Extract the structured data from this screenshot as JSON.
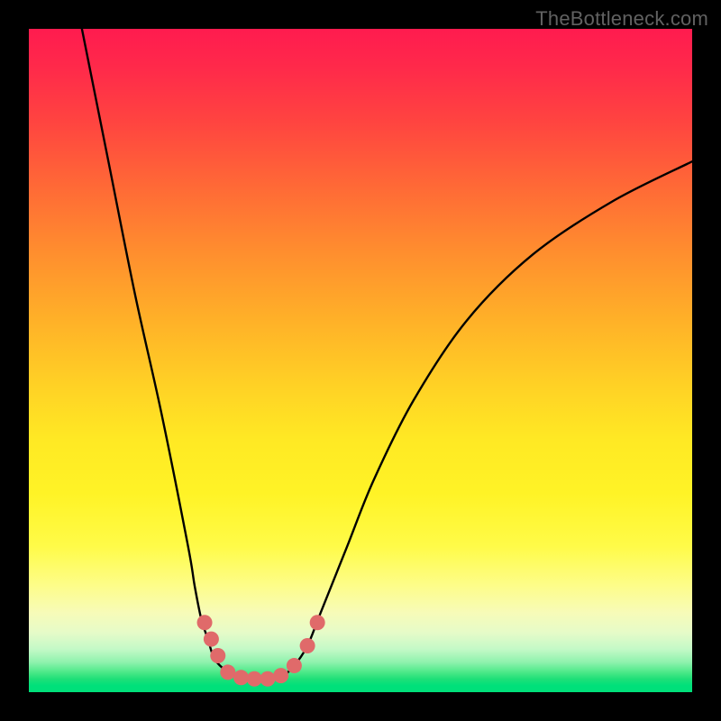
{
  "watermark": {
    "text": "TheBottleneck.com"
  },
  "chart_data": {
    "type": "line",
    "title": "",
    "xlabel": "",
    "ylabel": "",
    "xlim": [
      0,
      100
    ],
    "ylim": [
      0,
      100
    ],
    "series": [
      {
        "name": "left-branch",
        "x": [
          8,
          12,
          16,
          20,
          24,
          25,
          26,
          27,
          28,
          30,
          32
        ],
        "y": [
          100,
          80,
          60,
          42,
          22,
          16,
          11,
          8,
          5,
          3,
          2
        ]
      },
      {
        "name": "right-branch",
        "x": [
          38,
          40,
          42,
          44,
          48,
          52,
          58,
          66,
          76,
          88,
          100
        ],
        "y": [
          2,
          4,
          7,
          12,
          22,
          32,
          44,
          56,
          66,
          74,
          80
        ]
      }
    ],
    "markers": {
      "name": "bottleneck-points",
      "color": "#e06a6a",
      "points": [
        {
          "x": 26.5,
          "y": 10.5
        },
        {
          "x": 27.5,
          "y": 8.0
        },
        {
          "x": 28.5,
          "y": 5.5
        },
        {
          "x": 30.0,
          "y": 3.0
        },
        {
          "x": 32.0,
          "y": 2.2
        },
        {
          "x": 34.0,
          "y": 2.0
        },
        {
          "x": 36.0,
          "y": 2.0
        },
        {
          "x": 38.0,
          "y": 2.5
        },
        {
          "x": 40.0,
          "y": 4.0
        },
        {
          "x": 42.0,
          "y": 7.0
        },
        {
          "x": 43.5,
          "y": 10.5
        }
      ]
    },
    "gradient_stops": [
      {
        "pos": 0.0,
        "color": "#ff1b4f"
      },
      {
        "pos": 0.5,
        "color": "#ffe024"
      },
      {
        "pos": 0.9,
        "color": "#f9fcc0"
      },
      {
        "pos": 1.0,
        "color": "#00e07a"
      }
    ]
  }
}
